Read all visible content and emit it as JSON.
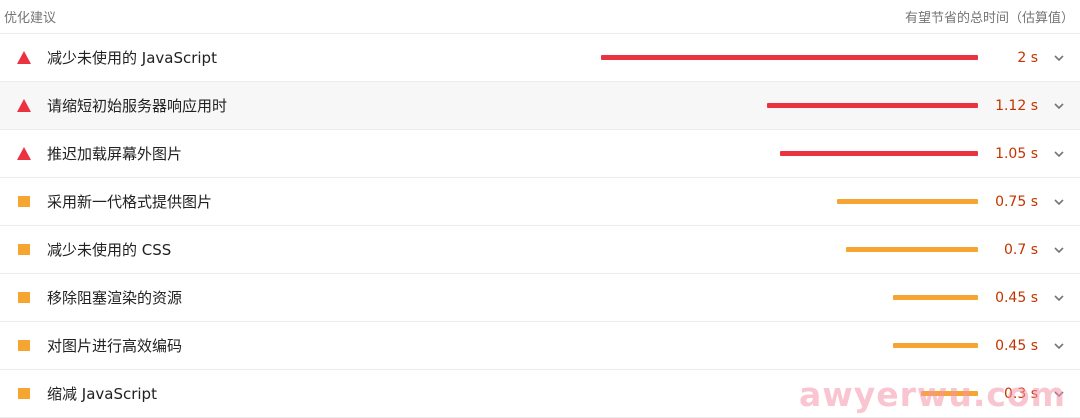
{
  "header": {
    "left_label": "优化建议",
    "right_label": "有望节省的总时间（估算值）"
  },
  "colors": {
    "fail": "#eb3240",
    "average": "#f6a532",
    "value_text": "#c33300"
  },
  "max_savings_s": 2,
  "audits": [
    {
      "title": "减少未使用的 JavaScript",
      "value": "2 s",
      "savings_s": 2,
      "severity": "fail",
      "icon": "red-triangle-icon"
    },
    {
      "title": "请缩短初始服务器响应用时",
      "value": "1.12 s",
      "savings_s": 1.12,
      "severity": "fail",
      "icon": "red-triangle-icon"
    },
    {
      "title": "推迟加载屏幕外图片",
      "value": "1.05 s",
      "savings_s": 1.05,
      "severity": "fail",
      "icon": "red-triangle-icon"
    },
    {
      "title": "采用新一代格式提供图片",
      "value": "0.75 s",
      "savings_s": 0.75,
      "severity": "average",
      "icon": "orange-square-icon"
    },
    {
      "title": "减少未使用的 CSS",
      "value": "0.7 s",
      "savings_s": 0.7,
      "severity": "average",
      "icon": "orange-square-icon"
    },
    {
      "title": "移除阻塞渲染的资源",
      "value": "0.45 s",
      "savings_s": 0.45,
      "severity": "average",
      "icon": "orange-square-icon"
    },
    {
      "title": "对图片进行高效编码",
      "value": "0.45 s",
      "savings_s": 0.45,
      "severity": "average",
      "icon": "orange-square-icon"
    },
    {
      "title": "缩减 JavaScript",
      "value": "0.3 s",
      "savings_s": 0.3,
      "severity": "average",
      "icon": "orange-square-icon"
    }
  ],
  "watermark": "awyerwu.com"
}
